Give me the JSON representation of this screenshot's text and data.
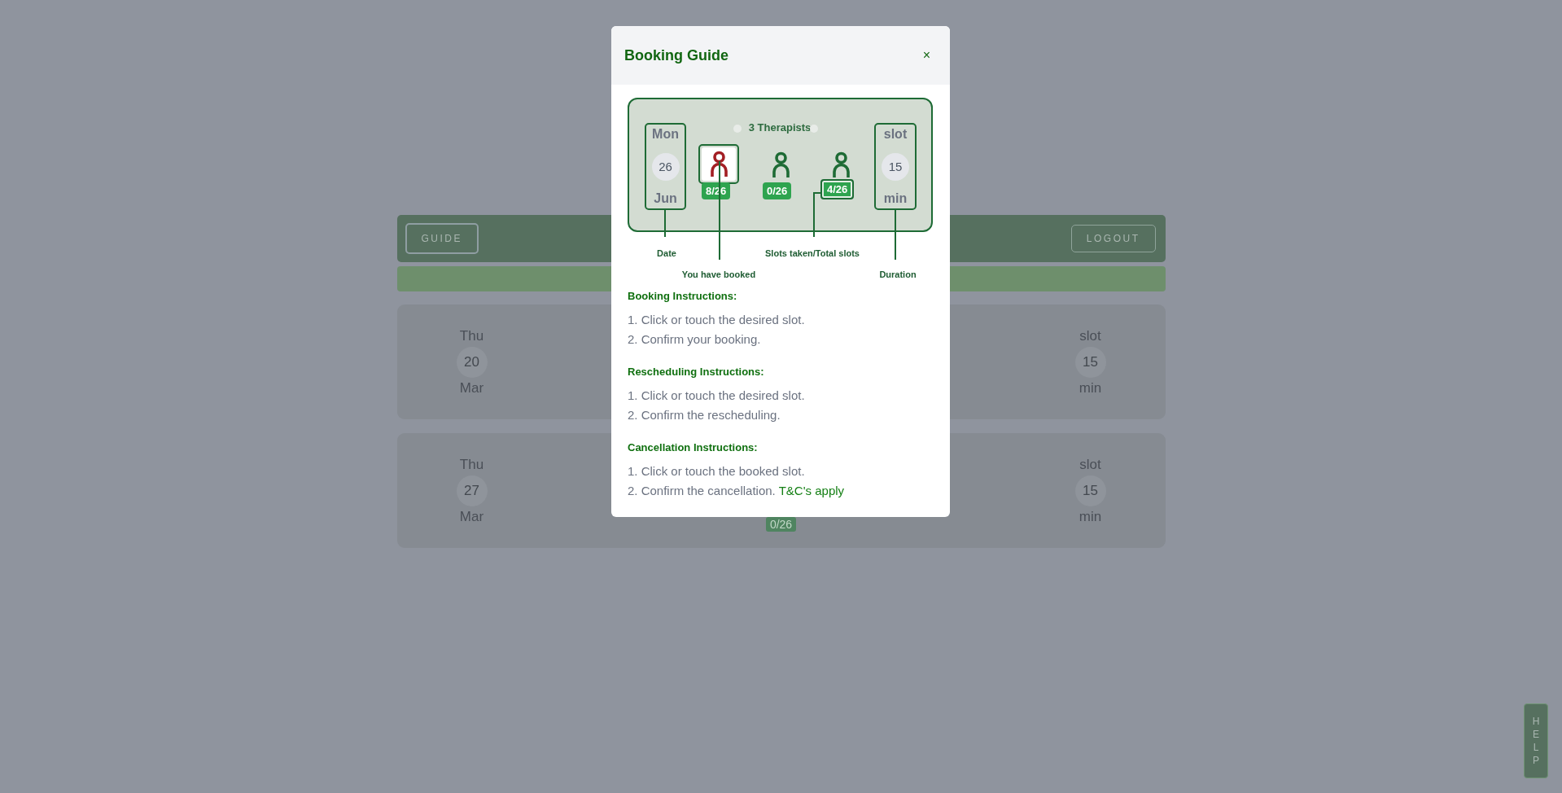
{
  "header": {
    "guide_button": "GUIDE",
    "logout_button": "LOGOUT"
  },
  "cards": [
    {
      "day": "Thu",
      "date": "20",
      "month": "Mar",
      "duration": {
        "top": "slot",
        "value": "15",
        "unit": "min"
      }
    },
    {
      "day": "Thu",
      "date": "27",
      "month": "Mar",
      "slots": "0/26",
      "duration": {
        "top": "slot",
        "value": "15",
        "unit": "min"
      }
    }
  ],
  "modal": {
    "title": "Booking Guide",
    "close": "×",
    "diagram": {
      "therapists_label": "3 Therapists",
      "date": {
        "day": "Mon",
        "date": "26",
        "month": "Jun"
      },
      "therapists": [
        {
          "booked": true,
          "highlighted": false,
          "slots": "8/26"
        },
        {
          "booked": false,
          "highlighted": false,
          "slots": "0/26"
        },
        {
          "booked": false,
          "highlighted": true,
          "slots": "4/26"
        }
      ],
      "duration": {
        "top": "slot",
        "value": "15",
        "unit": "min"
      },
      "callouts": [
        "Date",
        "You have booked",
        "Slots taken/Total slots",
        "Duration"
      ]
    },
    "sections": [
      {
        "heading": "Booking Instructions:",
        "steps": [
          {
            "text": "1. Click or touch the desired slot."
          },
          {
            "text": "2. Confirm your booking."
          }
        ]
      },
      {
        "heading": "Rescheduling Instructions:",
        "steps": [
          {
            "text": "1. Click or touch the desired slot."
          },
          {
            "text": "2. Confirm the rescheduling."
          }
        ]
      },
      {
        "heading": "Cancellation Instructions:",
        "steps": [
          {
            "text": "1. Click or touch the booked slot."
          },
          {
            "text": "2. Confirm the cancellation.",
            "link": "T&C's apply"
          }
        ]
      }
    ]
  },
  "help_button": "HELP"
}
